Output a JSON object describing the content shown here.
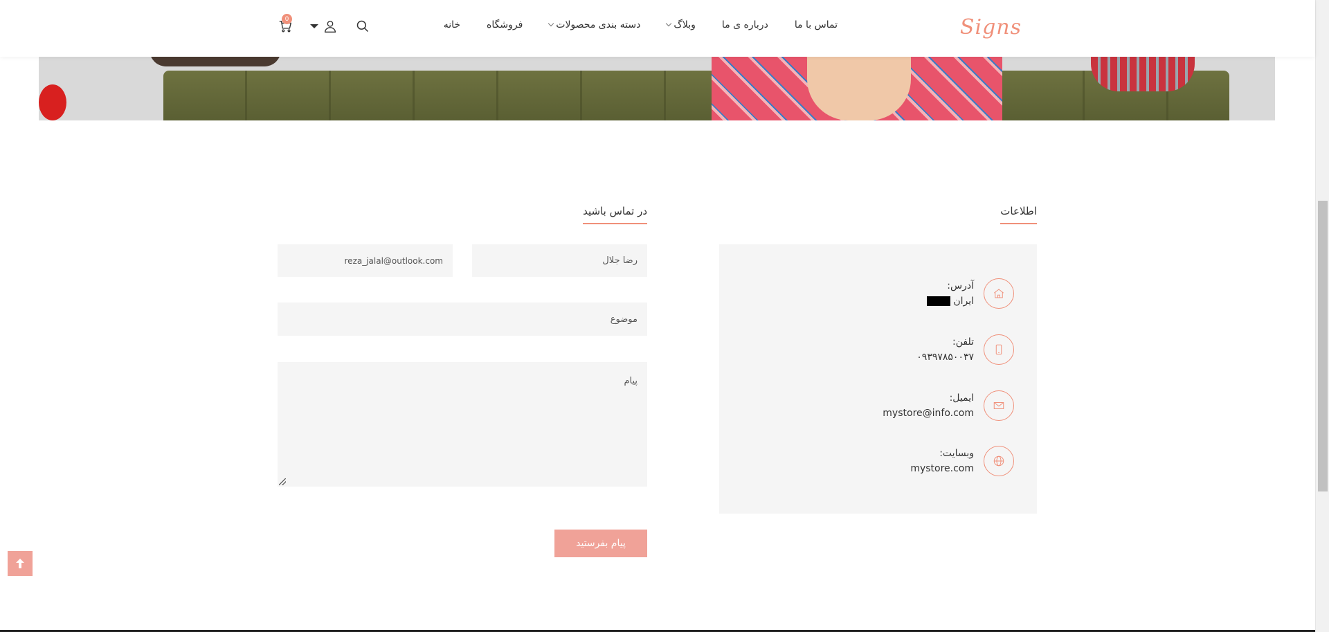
{
  "header": {
    "logo": "Signs",
    "nav": [
      {
        "label": "خانه"
      },
      {
        "label": "فروشگاه"
      },
      {
        "label": "دسته بندی محصولات",
        "dropdown": true
      },
      {
        "label": "وبلاگ",
        "dropdown": true
      },
      {
        "label": "درباره ی ما"
      },
      {
        "label": "تماس با ما"
      }
    ],
    "cart_count": "0",
    "icons": [
      "search-icon",
      "user-icon",
      "cart-icon"
    ]
  },
  "info": {
    "title": "اطلاعات",
    "items": [
      {
        "label": "آدرس:",
        "value": "ایران",
        "icon": "home-icon"
      },
      {
        "label": "تلفن:",
        "value": "۰۹۳۹۷۸۵۰۰۳۷",
        "icon": "phone-icon"
      },
      {
        "label": "ایمیل:",
        "value": "mystore@info.com",
        "icon": "mail-icon"
      },
      {
        "label": "وبسایت:",
        "value": "mystore.com",
        "icon": "globe-icon"
      }
    ]
  },
  "contact": {
    "title": "در تماس باشید",
    "name_value": "رضا جلال",
    "email_value": "reza_jalal@outlook.com",
    "subject_placeholder": "موضوع",
    "message_placeholder": "پیام",
    "submit_label": "پیام بفرستید"
  },
  "colors": {
    "accent": "#f0907a",
    "button": "#f0a298",
    "field_bg": "#f5f5f5"
  }
}
